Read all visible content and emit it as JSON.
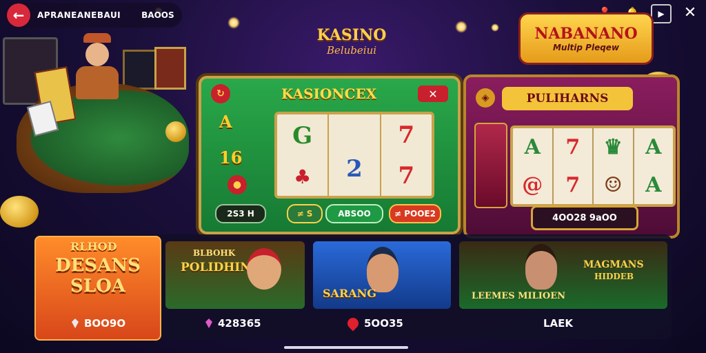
{
  "topbar": {
    "back_label": "←",
    "title": "APRANEANEBAUI",
    "balance": "BAOOS"
  },
  "top_icons": [
    "pin-icon",
    "bell-icon",
    "share-icon",
    "close-icon"
  ],
  "brand": {
    "title": "NABANANO",
    "subtitle": "Multip Pleqew"
  },
  "kasino_sign": {
    "top": "KASINO",
    "bottom": "Belubeiui"
  },
  "slot_main": {
    "title": "KASIONCEX",
    "close_label": "✕",
    "side_labels": [
      "A",
      "16"
    ],
    "reels": [
      [
        "G",
        "♣"
      ],
      [
        "",
        "2"
      ],
      [
        "7",
        "7"
      ]
    ],
    "buttons": {
      "left": "2S3 H",
      "mid_left": "≠ S",
      "mid": "ABSOO",
      "right": "≠ POOE2"
    }
  },
  "slot_right": {
    "title": "PULIHARNS",
    "reels": [
      [
        "A",
        "@"
      ],
      [
        "7",
        "7"
      ],
      [
        "♛",
        "☺"
      ],
      [
        "A",
        "A"
      ]
    ],
    "balance": "4OO28 9aOO"
  },
  "cards": [
    {
      "title_top": "RLHOD",
      "title_main": "DESANS SLOA",
      "caption": "BOO9O"
    },
    {
      "title_top": "BLBOHK",
      "title_main": "POLIDHIN",
      "caption": "428365"
    },
    {
      "title_top": "",
      "title_main": "SARANG",
      "caption": "5OO35"
    },
    {
      "title_top": "MAGMANS",
      "title_main": "LEEMES MILIOEN",
      "sub": "HIDDEB",
      "caption": "LAEK"
    }
  ],
  "colors": {
    "accent_red": "#d8283b",
    "gold": "#ffcf4a",
    "green": "#1f8f3e",
    "purple": "#6a1248"
  }
}
